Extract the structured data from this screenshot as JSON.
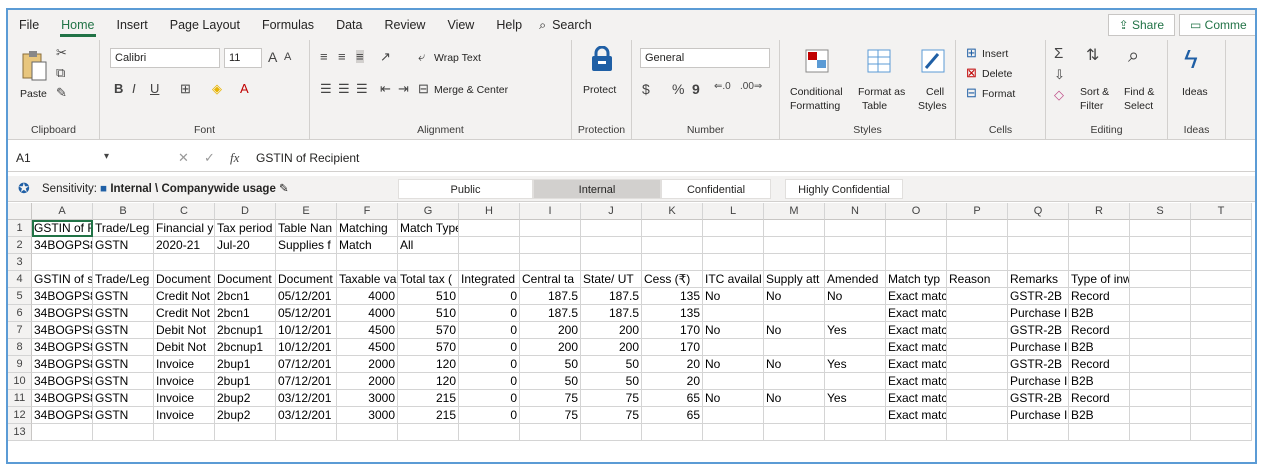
{
  "menu": {
    "items": [
      "File",
      "Home",
      "Insert",
      "Page Layout",
      "Formulas",
      "Data",
      "Review",
      "View",
      "Help"
    ],
    "search": "Search",
    "share": "Share",
    "comments": "Comme"
  },
  "ribbon": {
    "clipboard": {
      "label": "Clipboard",
      "paste": "Paste"
    },
    "font": {
      "label": "Font",
      "name": "Calibri",
      "size": "11",
      "grow": "A",
      "shrink": "A",
      "bold": "B",
      "italic": "I",
      "underline": "U"
    },
    "alignment": {
      "label": "Alignment",
      "wrap": "Wrap Text",
      "merge": "Merge & Center"
    },
    "protection": {
      "label": "Protection",
      "protect": "Protect"
    },
    "number": {
      "label": "Number",
      "format": "General",
      "currency": "$",
      "percent": "%",
      "comma": "9"
    },
    "styles": {
      "label": "Styles",
      "conditional_1": "Conditional",
      "conditional_2": "Formatting",
      "format_table_1": "Format as",
      "format_table_2": "Table",
      "cell_styles_1": "Cell",
      "cell_styles_2": "Styles"
    },
    "cells": {
      "label": "Cells",
      "insert": "Insert",
      "delete": "Delete",
      "format": "Format"
    },
    "editing": {
      "label": "Editing",
      "sort_1": "Sort &",
      "sort_2": "Filter",
      "find_1": "Find &",
      "find_2": "Select"
    },
    "ideas": {
      "label": "Ideas",
      "button": "Ideas"
    }
  },
  "formula_bar": {
    "cell_ref": "A1",
    "fx": "fx",
    "content": "GSTIN of Recipient"
  },
  "sensitivity": {
    "label": "Sensitivity:",
    "current": "Internal \\ Companywide usage",
    "options": [
      "Public",
      "Internal",
      "Confidential",
      "Highly Confidential"
    ]
  },
  "sheet": {
    "columns": [
      "A",
      "B",
      "C",
      "D",
      "E",
      "F",
      "G",
      "H",
      "I",
      "J",
      "K",
      "L",
      "M",
      "N",
      "O",
      "P",
      "Q",
      "R",
      "S",
      "T"
    ],
    "rows": [
      [
        "1",
        "GSTIN of R",
        "Trade/Leg",
        "Financial y",
        "Tax period",
        "Table Nan",
        "Matching",
        "Match Type",
        "",
        "",
        "",
        "",
        "",
        "",
        "",
        "",
        "",
        "",
        "",
        "",
        ""
      ],
      [
        "2",
        "34BOGPS8",
        "GSTN",
        "2020-21",
        "Jul-20",
        "Supplies f",
        "Match",
        "All",
        "",
        "",
        "",
        "",
        "",
        "",
        "",
        "",
        "",
        "",
        "",
        "",
        ""
      ],
      [
        "3",
        "",
        "",
        "",
        "",
        "",
        "",
        "",
        "",
        "",
        "",
        "",
        "",
        "",
        "",
        "",
        "",
        "",
        "",
        "",
        ""
      ],
      [
        "4",
        "GSTIN of s",
        "Trade/Leg",
        "Document",
        "Document",
        "Document",
        "Taxable va",
        "Total tax (",
        "Integrated",
        "Central  ta",
        "State/ UT",
        "Cess (₹)",
        "ITC availal",
        "Supply att",
        "Amended",
        "Match typ",
        "Reason",
        "Remarks",
        "Type of inward supply",
        "",
        ""
      ],
      [
        "5",
        "34BOGPS8",
        "GSTN",
        "Credit Not",
        "2bcn1",
        "05/12/201",
        "4000",
        "510",
        "0",
        "187.5",
        "187.5",
        "135",
        "No",
        "No",
        "No",
        "Exact match",
        "",
        "GSTR-2B",
        "Record",
        "",
        ""
      ],
      [
        "6",
        "34BOGPS8",
        "GSTN",
        "Credit Not",
        "2bcn1",
        "05/12/201",
        "4000",
        "510",
        "0",
        "187.5",
        "187.5",
        "135",
        "",
        "",
        "",
        "Exact match",
        "",
        "Purchase I",
        "B2B",
        "",
        ""
      ],
      [
        "7",
        "34BOGPS8",
        "GSTN",
        "Debit Not",
        "2bcnup1",
        "10/12/201",
        "4500",
        "570",
        "0",
        "200",
        "200",
        "170",
        "No",
        "No",
        "Yes",
        "Exact match",
        "",
        "GSTR-2B",
        "Record",
        "",
        ""
      ],
      [
        "8",
        "34BOGPS8",
        "GSTN",
        "Debit Not",
        "2bcnup1",
        "10/12/201",
        "4500",
        "570",
        "0",
        "200",
        "200",
        "170",
        "",
        "",
        "",
        "Exact match",
        "",
        "Purchase I",
        "B2B",
        "",
        ""
      ],
      [
        "9",
        "34BOGPS8",
        "GSTN",
        "Invoice",
        "2bup1",
        "07/12/201",
        "2000",
        "120",
        "0",
        "50",
        "50",
        "20",
        "No",
        "No",
        "Yes",
        "Exact match",
        "",
        "GSTR-2B",
        "Record",
        "",
        ""
      ],
      [
        "10",
        "34BOGPS8",
        "GSTN",
        "Invoice",
        "2bup1",
        "07/12/201",
        "2000",
        "120",
        "0",
        "50",
        "50",
        "20",
        "",
        "",
        "",
        "Exact match",
        "",
        "Purchase I",
        "B2B",
        "",
        ""
      ],
      [
        "11",
        "34BOGPS8",
        "GSTN",
        "Invoice",
        "2bup2",
        "03/12/201",
        "3000",
        "215",
        "0",
        "75",
        "75",
        "65",
        "No",
        "No",
        "Yes",
        "Exact match",
        "",
        "GSTR-2B",
        "Record",
        "",
        ""
      ],
      [
        "12",
        "34BOGPS8",
        "GSTN",
        "Invoice",
        "2bup2",
        "03/12/201",
        "3000",
        "215",
        "0",
        "75",
        "75",
        "65",
        "",
        "",
        "",
        "Exact match",
        "",
        "Purchase I",
        "B2B",
        "",
        ""
      ],
      [
        "13",
        "",
        "",
        "",
        "",
        "",
        "",
        "",
        "",
        "",
        "",
        "",
        "",
        "",
        "",
        "",
        "",
        "",
        "",
        "",
        ""
      ]
    ]
  },
  "colors": {
    "accent": "#217346",
    "frame": "#5b9bd5"
  }
}
